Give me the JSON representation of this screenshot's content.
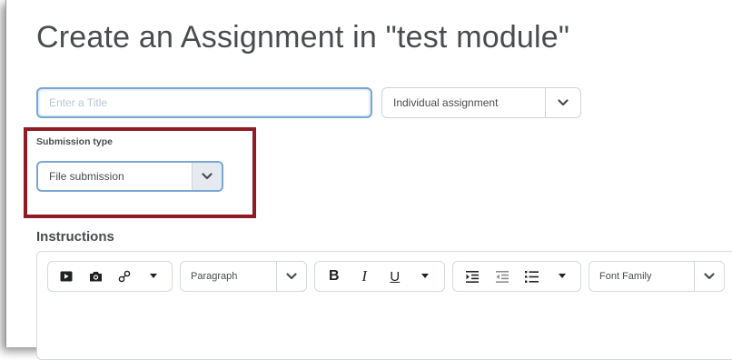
{
  "page": {
    "title": "Create an Assignment in \"test module\""
  },
  "title_field": {
    "placeholder": "Enter a Title",
    "value": ""
  },
  "assignment_type": {
    "selected": "Individual assignment"
  },
  "submission": {
    "label": "Submission type",
    "selected": "File submission",
    "highlight_color": "#8f1b24"
  },
  "instructions": {
    "label": "Instructions",
    "toolbar": {
      "insert_group": [
        "insert-video-icon",
        "insert-image-icon",
        "insert-link-icon",
        "more-dropdown-icon"
      ],
      "block_format": "Paragraph",
      "text_format": [
        "B",
        "I",
        "U"
      ],
      "list_group": [
        "indent-icon",
        "outdent-icon",
        "bullet-list-icon",
        "more-dropdown-icon"
      ],
      "font_family": "Font Family"
    }
  },
  "colors": {
    "accent_border": "#79a7d2",
    "text": "#494c4e",
    "border": "#cfd3d7"
  }
}
